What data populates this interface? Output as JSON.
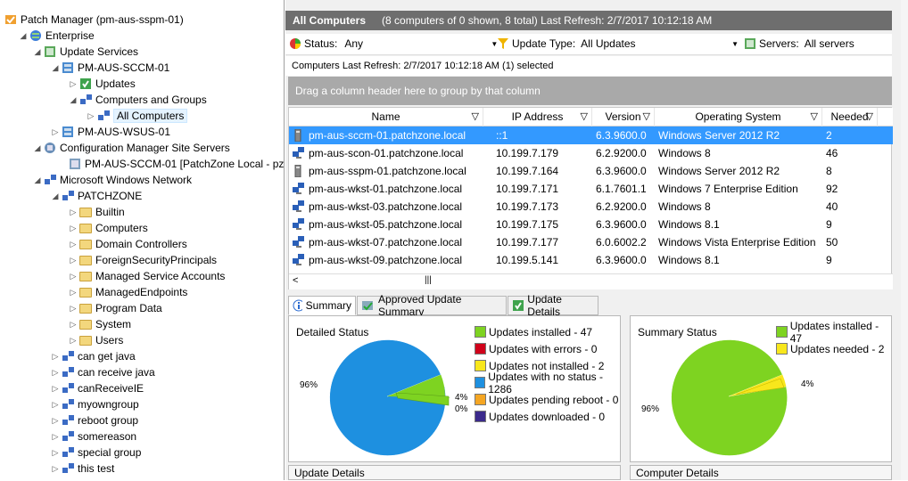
{
  "tree": {
    "root": "Patch Manager (pm-aus-sspm-01)",
    "enterprise": "Enterprise",
    "update_services": "Update Services",
    "sccm01": "PM-AUS-SCCM-01",
    "updates": "Updates",
    "computers_groups": "Computers and Groups",
    "all_computers": "All Computers",
    "wsus01": "PM-AUS-WSUS-01",
    "cm_site_servers": "Configuration Manager Site Servers",
    "cm_server": "PM-AUS-SCCM-01 [PatchZone Local - pz",
    "ms_windows_network": "Microsoft Windows Network",
    "patchzone": "PATCHZONE",
    "folders": [
      "Builtin",
      "Computers",
      "Domain Controllers",
      "ForeignSecurityPrincipals",
      "Managed Service Accounts",
      "ManagedEndpoints",
      "Program Data",
      "System",
      "Users"
    ],
    "groups": [
      "can get java",
      "can receive java",
      "canReceiveIE",
      "myowngroup",
      "reboot group",
      "somereason",
      "special group",
      "this test"
    ]
  },
  "header": {
    "title": "All Computers",
    "status_text": "(8 computers of 0 shown, 8 total) Last Refresh: 2/7/2017 10:12:18 AM"
  },
  "filters": {
    "status_label": "Status:",
    "status_value": "Any",
    "update_type_label": "Update Type:",
    "update_type_value": "All Updates",
    "servers_label": "Servers:",
    "servers_value": "All servers"
  },
  "refresh_line": "Computers Last Refresh: 2/7/2017 10:12:18 AM  (1) selected",
  "group_hint": "Drag a column header here to group by that column",
  "columns": [
    "Name",
    "IP Address",
    "Version",
    "Operating System",
    "Needed"
  ],
  "rows": [
    {
      "name": "pm-aus-sccm-01.patchzone.local",
      "ip": "::1",
      "version": "6.3.9600.0",
      "os": "Windows Server 2012 R2",
      "needed": "2",
      "icon": "server"
    },
    {
      "name": "pm-aus-scon-01.patchzone.local",
      "ip": "10.199.7.179",
      "version": "6.2.9200.0",
      "os": "Windows 8",
      "needed": "46",
      "icon": "workstation"
    },
    {
      "name": "pm-aus-sspm-01.patchzone.local",
      "ip": "10.199.7.164",
      "version": "6.3.9600.0",
      "os": "Windows Server 2012 R2",
      "needed": "8",
      "icon": "server"
    },
    {
      "name": "pm-aus-wkst-01.patchzone.local",
      "ip": "10.199.7.171",
      "version": "6.1.7601.1",
      "os": "Windows 7 Enterprise Edition",
      "needed": "92",
      "icon": "workstation"
    },
    {
      "name": "pm-aus-wkst-03.patchzone.local",
      "ip": "10.199.7.173",
      "version": "6.2.9200.0",
      "os": "Windows 8",
      "needed": "40",
      "icon": "workstation"
    },
    {
      "name": "pm-aus-wkst-05.patchzone.local",
      "ip": "10.199.7.175",
      "version": "6.3.9600.0",
      "os": "Windows 8.1",
      "needed": "9",
      "icon": "workstation"
    },
    {
      "name": "pm-aus-wkst-07.patchzone.local",
      "ip": "10.199.7.177",
      "version": "6.0.6002.2",
      "os": "Windows Vista Enterprise Edition",
      "needed": "50",
      "icon": "workstation"
    },
    {
      "name": "pm-aus-wkst-09.patchzone.local",
      "ip": "10.199.5.141",
      "version": "6.3.9600.0",
      "os": "Windows 8.1",
      "needed": "9",
      "icon": "workstation"
    }
  ],
  "tabs": [
    "Summary",
    "Approved Update Summary",
    "Update Details"
  ],
  "detailed": {
    "title": "Detailed Status",
    "legend": [
      {
        "label": "Updates installed - 47",
        "color": "#7ed321"
      },
      {
        "label": "Updates with errors - 0",
        "color": "#d0021b"
      },
      {
        "label": "Updates not installed - 2",
        "color": "#f8e71c"
      },
      {
        "label": "Updates with no status - 1286",
        "color": "#1e90e0"
      },
      {
        "label": "Updates pending reboot - 0",
        "color": "#f5a623"
      },
      {
        "label": "Updates downloaded - 0",
        "color": "#3b2a8c"
      }
    ],
    "pct_96": "96%",
    "pct_4": "4%",
    "pct_0": "0%"
  },
  "summary": {
    "title": "Summary Status",
    "legend": [
      {
        "label": "Updates installed - 47",
        "color": "#7ed321"
      },
      {
        "label": "Updates needed - 2",
        "color": "#f8e71c"
      }
    ],
    "pct_96": "96%",
    "pct_4": "4%"
  },
  "bottom": {
    "left": "Update Details",
    "right": "Computer Details"
  }
}
